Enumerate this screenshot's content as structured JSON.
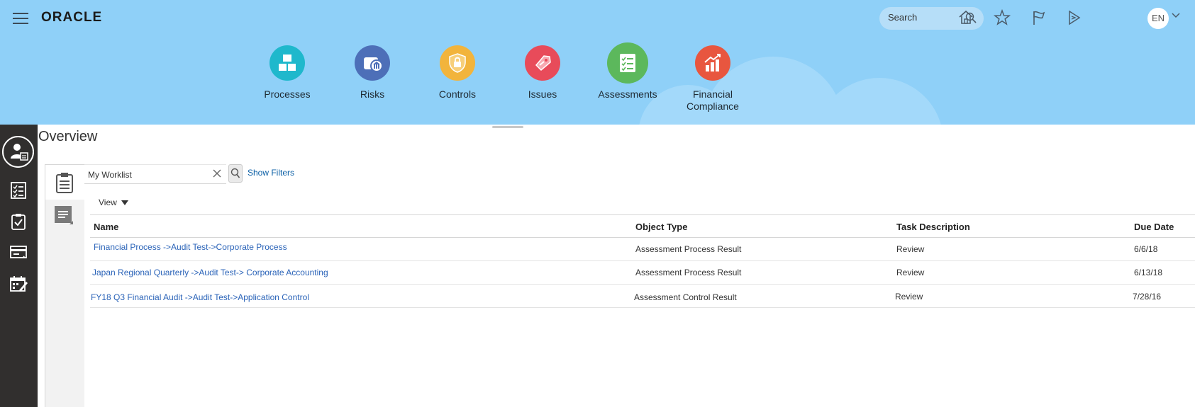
{
  "header": {
    "logo": "ORACLE",
    "search_placeholder": "Search",
    "avatar_initials": "EN"
  },
  "nav": {
    "tiles": [
      {
        "label": "Processes",
        "color": "#1fb8cc"
      },
      {
        "label": "Risks",
        "color": "#4d6fb8"
      },
      {
        "label": "Controls",
        "color": "#f2b43c"
      },
      {
        "label": "Issues",
        "color": "#e84b5a"
      },
      {
        "label": "Assessments",
        "color": "#5cb85c"
      },
      {
        "label": "Financial",
        "label2": "Compliance",
        "color": "#e8563f"
      }
    ]
  },
  "page": {
    "title": "Overview"
  },
  "worklist": {
    "saved_search": "My Worklist",
    "show_filters": "Show Filters",
    "view_label": "View",
    "columns": [
      "Name",
      "Object Type",
      "Task Description",
      "Due Date"
    ],
    "rows": [
      {
        "name": "Financial Process ->Audit Test->Corporate Process",
        "object_type": "Assessment Process Result",
        "task": "Review",
        "due": "6/6/18"
      },
      {
        "name": "Japan Regional Quarterly ->Audit Test-> Corporate Accounting",
        "object_type": "Assessment Process Result",
        "task": "Review",
        "due": "6/13/18"
      },
      {
        "name": "FY18 Q3 Financial Audit ->Audit Test->Application Control",
        "object_type": "Assessment Control Result",
        "task": "Review",
        "due": "7/28/16"
      }
    ]
  }
}
